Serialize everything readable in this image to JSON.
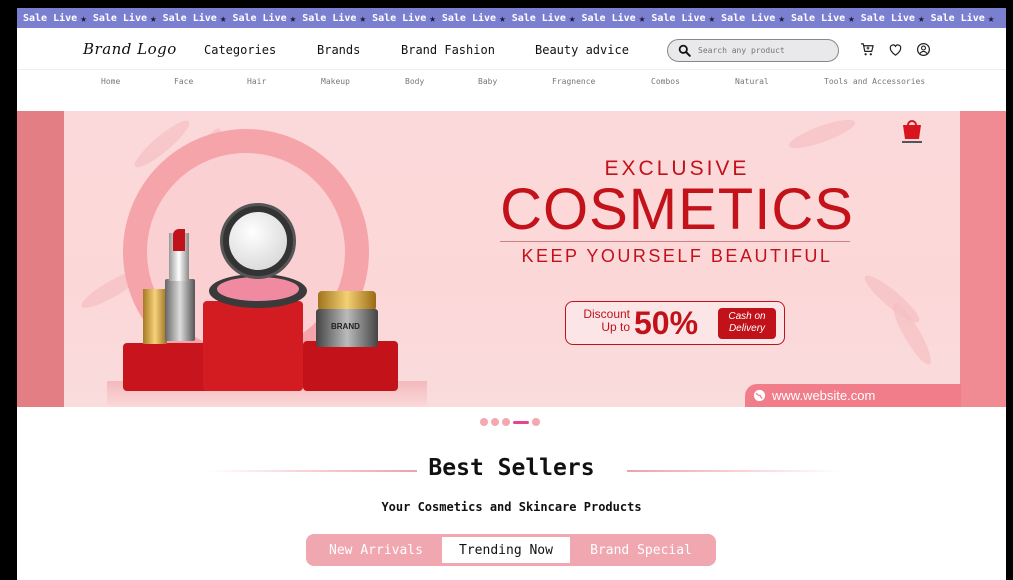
{
  "marquee": {
    "text": "Sale Live",
    "repeat": 14,
    "star": "★"
  },
  "header": {
    "logo": "Brand Logo",
    "nav": [
      "Categories",
      "Brands",
      "Brand Fashion",
      "Beauty advice"
    ],
    "search_placeholder": "Search any product",
    "icons": [
      "cart-icon",
      "heart-icon",
      "user-icon"
    ]
  },
  "subnav": [
    "Home",
    "Face",
    "Hair",
    "Makeup",
    "Body",
    "Baby",
    "Fragnence",
    "Combos",
    "Natural",
    "Tools and Accessories"
  ],
  "banner": {
    "exclusive": "EXCLUSIVE",
    "headline": "COSMETICS",
    "tagline": "KEEP YOURSELF BEAUTIFUL",
    "discount_label_1": "Discount",
    "discount_label_2": "Up to",
    "discount_value": "50%",
    "cash_1": "Cash on",
    "cash_2": "Delivery",
    "website": "www.website.com",
    "product_label": "BRAND",
    "colors": {
      "accent": "#c1121a",
      "bg": "#fbd9da",
      "band": "#f08a93"
    }
  },
  "carousel": {
    "count": 5,
    "active_index": 3
  },
  "best_sellers": {
    "title": "Best Sellers",
    "subtitle": "Your Cosmetics and Skincare Products",
    "tabs": [
      "New Arrivals",
      "Trending Now",
      "Brand Special"
    ],
    "active_tab": 1
  }
}
